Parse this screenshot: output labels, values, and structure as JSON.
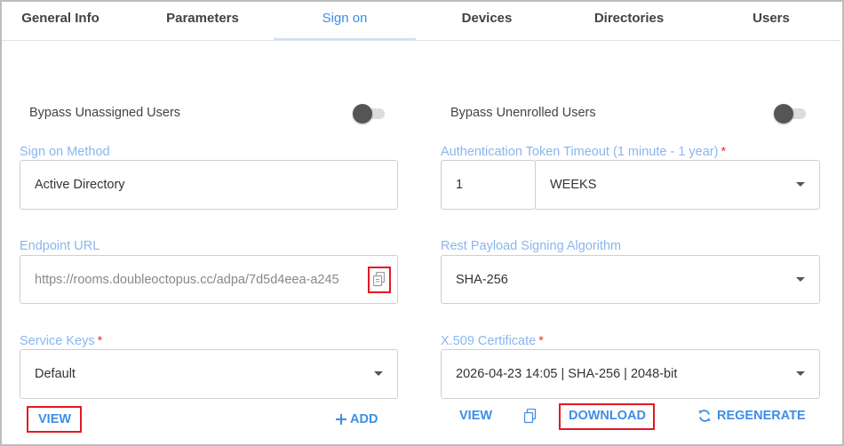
{
  "tabs": [
    {
      "label": "General Info"
    },
    {
      "label": "Parameters"
    },
    {
      "label": "Sign on",
      "active": true
    },
    {
      "label": "Devices"
    },
    {
      "label": "Directories"
    },
    {
      "label": "Users"
    }
  ],
  "left": {
    "bypass_unassigned_label": "Bypass Unassigned Users",
    "bypass_unassigned_on": false,
    "sign_on_method": {
      "label": "Sign on Method",
      "value": "Active Directory"
    },
    "endpoint_url": {
      "label": "Endpoint URL",
      "value": "https://rooms.doubleoctopus.cc/adpa/7d5d4eea-a245",
      "copy_icon": "copy-icon"
    },
    "service_keys": {
      "label": "Service Keys",
      "required_mark": "*",
      "value": "Default"
    },
    "view_label": "VIEW",
    "add_label": "ADD",
    "add_icon": "plus-icon"
  },
  "right": {
    "bypass_unenrolled_label": "Bypass Unenrolled Users",
    "bypass_unenrolled_on": false,
    "auth_timeout": {
      "label": "Authentication Token Timeout (1 minute - 1 year)",
      "required_mark": "*",
      "amount": "1",
      "unit": "WEEKS"
    },
    "rest_payload": {
      "label": "Rest Payload Signing Algorithm",
      "value": "SHA-256"
    },
    "x509": {
      "label": "X.509 Certificate",
      "required_mark": "*",
      "value": "2026-04-23 14:05 | SHA-256 | 2048-bit"
    },
    "view_label": "VIEW",
    "copy_icon": "copy-icon",
    "download_label": "DOWNLOAD",
    "regenerate_label": "REGENERATE",
    "regenerate_icon": "refresh-icon"
  },
  "colors": {
    "accent": "#3d8ee8",
    "label": "#8ab6ee",
    "highlight": "#e21a23",
    "required": "#e53935"
  }
}
